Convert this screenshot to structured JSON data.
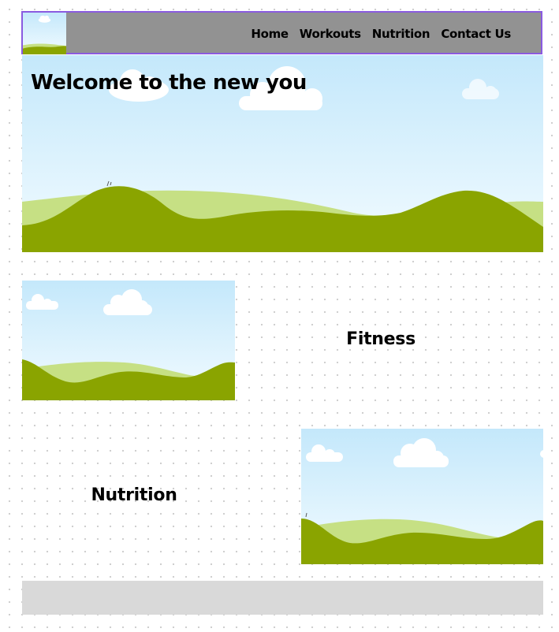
{
  "nav": {
    "links": [
      "Home",
      "Workouts",
      "Nutrition",
      "Contact Us"
    ],
    "logo_icon": "landscape-image-icon"
  },
  "hero": {
    "title": "Welcome to the new you",
    "image_icon": "landscape-image-icon"
  },
  "sections": [
    {
      "heading": "Fitness",
      "image_icon": "landscape-image-icon"
    },
    {
      "heading": "Nutrition",
      "image_icon": "landscape-image-icon"
    }
  ],
  "colors": {
    "nav_background": "#929292",
    "nav_border": "#8a5be0",
    "sky_top": "#c4e8fb",
    "sky_bottom": "#f2fbff",
    "hill_dark": "#8aa400",
    "hill_light": "#c6e084",
    "footer_background": "#d9d9d9"
  }
}
